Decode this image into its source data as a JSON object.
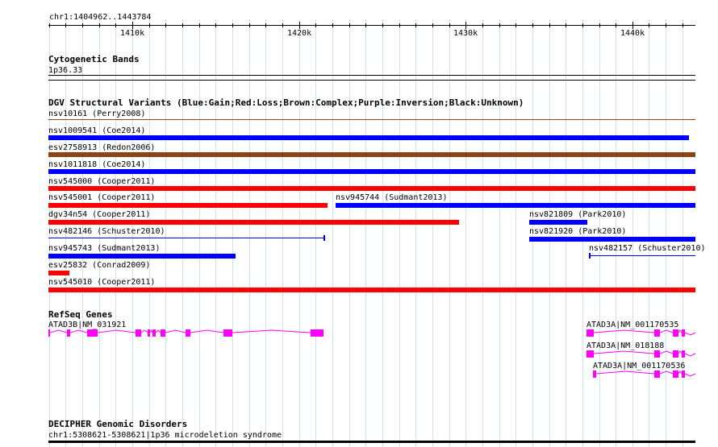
{
  "coords": "chr1:1404962..1443784",
  "ruler_ticks": [
    "1410k",
    "1420k",
    "1430k",
    "1440k"
  ],
  "tracks": {
    "cytobands": {
      "title": "Cytogenetic Bands",
      "band": "1p36.33"
    },
    "dgv": {
      "title": "DGV Structural Variants (Blue:Gain;Red:Loss;Brown:Complex;Purple:Inversion;Black:Unknown)",
      "colors": {
        "gain": "#0000ff",
        "loss": "#ff0000",
        "complex": "#8b4513",
        "inversion": "#800080",
        "unknown": "#000000"
      },
      "features": [
        {
          "name": "nsv10161 (Perry2008)",
          "type": "complex",
          "start": 1404962,
          "end": 1443784
        },
        {
          "name": "nsv1009541 (Coe2014)",
          "type": "gain",
          "start": 1404962,
          "end": 1443400
        },
        {
          "name": "esv2758913 (Redon2006)",
          "type": "complex",
          "start": 1404962,
          "end": 1443784
        },
        {
          "name": "nsv1011818 (Coe2014)",
          "type": "gain",
          "start": 1404962,
          "end": 1443784
        },
        {
          "name": "nsv545000 (Cooper2011)",
          "type": "loss",
          "start": 1404962,
          "end": 1443784
        },
        {
          "name": "nsv545001 (Cooper2011)",
          "type": "loss",
          "start": 1404962,
          "end": 1421700
        },
        {
          "name": "nsv945744 (Sudmant2013)",
          "type": "gain",
          "start": 1422200,
          "end": 1443784
        },
        {
          "name": "dgv34n54 (Cooper2011)",
          "type": "loss",
          "start": 1404962,
          "end": 1429600
        },
        {
          "name": "nsv821809 (Park2010)",
          "type": "gain",
          "start": 1433800,
          "end": 1437300
        },
        {
          "name": "nsv482146 (Schuster2010)",
          "type": "gain",
          "start": 1404962,
          "end": 1421500
        },
        {
          "name": "nsv821920 (Park2010)",
          "type": "gain",
          "start": 1433800,
          "end": 1443784
        },
        {
          "name": "nsv945743 (Sudmant2013)",
          "type": "gain",
          "start": 1404962,
          "end": 1416200
        },
        {
          "name": "nsv482157 (Schuster2010)",
          "type": "gain",
          "start": 1437400,
          "end": 1443784
        },
        {
          "name": "esv25832 (Conrad2009)",
          "type": "loss",
          "start": 1404962,
          "end": 1406200
        },
        {
          "name": "nsv545010 (Cooper2011)",
          "type": "loss",
          "start": 1404962,
          "end": 1443784
        }
      ]
    },
    "refseq": {
      "title": "RefSeq Genes",
      "color": "#ff00ff",
      "genes": [
        {
          "name": "ATAD3B|NM_031921",
          "strand": "+",
          "start": 1404962,
          "end": 1421500
        },
        {
          "name": "ATAD3A|NM_001170535",
          "strand": "+",
          "start": 1437300,
          "end": 1443784
        },
        {
          "name": "ATAD3A|NM_018188",
          "strand": "+",
          "start": 1437300,
          "end": 1443784
        },
        {
          "name": "ATAD3A|NM_001170536",
          "strand": "+",
          "start": 1437700,
          "end": 1443784
        }
      ]
    },
    "decipher": {
      "title": "DECIPHER Genomic Disorders",
      "feature": "chr1:5308621-5308621|1p36 microdeletion syndrome"
    }
  }
}
